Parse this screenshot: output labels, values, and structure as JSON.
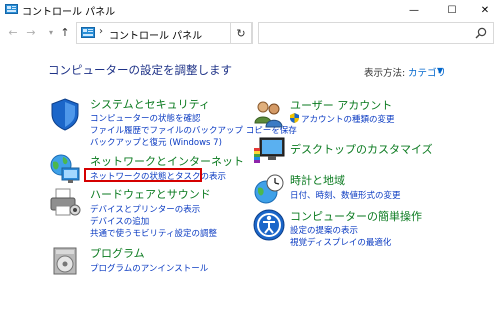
{
  "window": {
    "title": "コントロール パネル",
    "min_glyph": "—",
    "max_glyph": "☐",
    "close_glyph": "✕"
  },
  "nav": {
    "back_glyph": "←",
    "forward_glyph": "→",
    "recent_glyph": "▾",
    "up_glyph": "↑",
    "address_sep": "›",
    "address_text": "コントロール パネル",
    "address_dropdown_glyph": "▾",
    "refresh_glyph": "↻",
    "search_placeholder": ""
  },
  "heading": "コンピューターの設定を調整します",
  "view_by": {
    "label": "表示方法:",
    "value": "カテゴリ",
    "caret": "▼"
  },
  "categories": {
    "system": {
      "title": "システムとセキュリティ",
      "links": [
        "コンピューターの状態を確認",
        "ファイル履歴でファイルのバックアップ コピーを保存",
        "バックアップと復元 (Windows 7)"
      ]
    },
    "network": {
      "title": "ネットワークとインターネット",
      "links": [
        "ネットワークの状態とタスクの表示"
      ]
    },
    "hardware": {
      "title": "ハードウェアとサウンド",
      "links": [
        "デバイスとプリンターの表示",
        "デバイスの追加",
        "共通で使うモビリティ設定の調整"
      ]
    },
    "programs": {
      "title": "プログラム",
      "links": [
        "プログラムのアンインストール"
      ]
    },
    "user": {
      "title": "ユーザー アカウント",
      "links": [
        "アカウントの種類の変更"
      ]
    },
    "desktop": {
      "title": "デスクトップのカスタマイズ",
      "links": []
    },
    "clock": {
      "title": "時計と地域",
      "links": [
        "日付、時刻、数値形式の変更"
      ]
    },
    "access": {
      "title": "コンピューターの簡単操作",
      "links": [
        "設定の提案の表示",
        "視覚ディスプレイの最適化"
      ]
    }
  },
  "colors": {
    "heading": "#1e3287",
    "category_title": "#0a7a1f",
    "link": "#0b3bc2",
    "highlight": "#d50000"
  },
  "icons": [
    "control-panel-icon",
    "search-icon",
    "shield-icon",
    "network-globe-icon",
    "printer-icon",
    "programs-disc-icon",
    "users-icon",
    "monitor-palette-icon",
    "clock-globe-icon",
    "ease-of-access-icon",
    "uac-shield-icon"
  ]
}
